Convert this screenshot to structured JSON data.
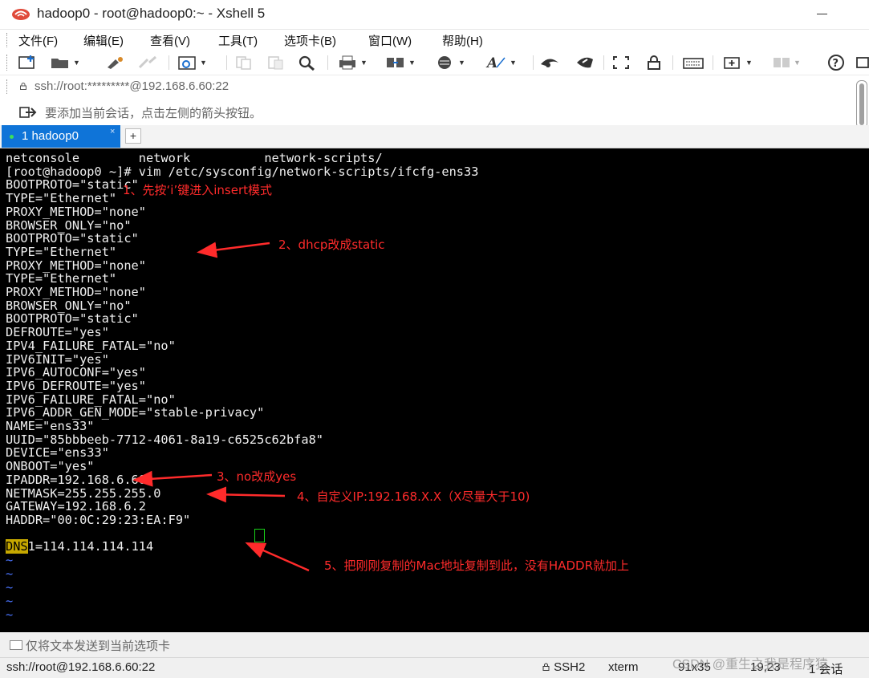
{
  "window": {
    "title": "hadoop0 - root@hadoop0:~ - Xshell 5"
  },
  "menu": [
    "文件(F)",
    "编辑(E)",
    "查看(V)",
    "工具(T)",
    "选项卡(B)",
    "窗口(W)",
    "帮助(H)"
  ],
  "toolbar_icons": [
    "new-session-icon",
    "open-folder-icon",
    "connect-icon",
    "disconnect-icon",
    "properties-icon",
    "copy-icon",
    "paste-icon",
    "find-icon",
    "print-icon",
    "transfer-icon",
    "globe-icon",
    "font-icon",
    "xftp-icon",
    "xmanager-icon",
    "fullscreen-icon",
    "lock-icon",
    "keyboard-icon",
    "new-tab-icon",
    "layout-icon",
    "help-icon"
  ],
  "address": {
    "text": "ssh://root:*********@192.168.6.60:22"
  },
  "hint": {
    "text": "要添加当前会话，点击左侧的箭头按钮。"
  },
  "tabs": [
    {
      "label": "1 hadoop0",
      "close": "×"
    }
  ],
  "tab_add": "+",
  "terminal": {
    "lines": [
      "netconsole        network          network-scripts/",
      "[root@hadoop0 ~]# vim /etc/sysconfig/network-scripts/ifcfg-ens33",
      "BOOTPROTO=\"static\"",
      "TYPE=\"Ethernet\"",
      "PROXY_METHOD=\"none\"",
      "BROWSER_ONLY=\"no\"",
      "BOOTPROTO=\"static\"",
      "TYPE=\"Ethernet\"",
      "PROXY_METHOD=\"none\"",
      "TYPE=\"Ethernet\"",
      "PROXY_METHOD=\"none\"",
      "BROWSER_ONLY=\"no\"",
      "BOOTPROTO=\"static\"",
      "DEFROUTE=\"yes\"",
      "IPV4_FAILURE_FATAL=\"no\"",
      "IPV6INIT=\"yes\"",
      "IPV6_AUTOCONF=\"yes\"",
      "IPV6_DEFROUTE=\"yes\"",
      "IPV6_FAILURE_FATAL=\"no\"",
      "IPV6_ADDR_GEN_MODE=\"stable-privacy\"",
      "NAME=\"ens33\"",
      "UUID=\"85bbbeeb-7712-4061-8a19-c6525c62bfa8\"",
      "DEVICE=\"ens33\"",
      "ONBOOT=\"yes\"",
      "IPADDR=192.168.6.60",
      "NETMASK=255.255.255.0",
      "GATEWAY=192.168.6.2",
      "HADDR=\"00:0C:29:23:EA:F9\""
    ],
    "dns_key": "DNS",
    "dns_rest": "1=114.114.114.114",
    "tildes": [
      "~",
      "~",
      "~",
      "~",
      "~"
    ]
  },
  "annotations": [
    "1、先按‘i’键进入insert模式",
    "2、dhcp改成static",
    "3、no改成yes",
    "4、自定义IP:192.168.X.X（X尽量大于10)",
    "5、把刚刚复制的Mac地址复制到此，没有HADDR就加上"
  ],
  "annotation_color": "#ff2b2b",
  "send_bar": {
    "text": "仅将文本发送到当前选项卡"
  },
  "status": {
    "connection": "ssh://root@192.168.6.60:22",
    "protocol": "SSH2",
    "term": "xterm",
    "size": "91x35",
    "position": "19,23",
    "sessions": "1 会话"
  },
  "watermark": "CSDN @重生之我是程序猿"
}
